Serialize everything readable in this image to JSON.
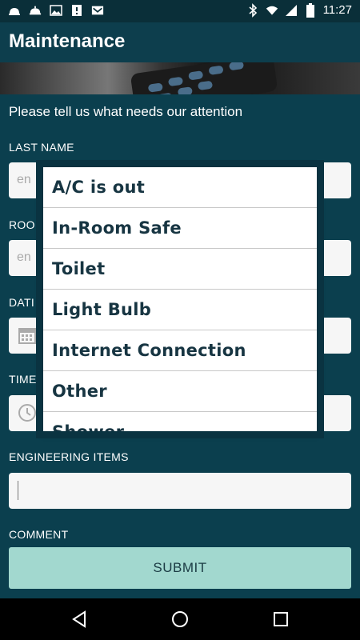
{
  "status_bar": {
    "time": "11:27",
    "left_icons": [
      "bell-icon",
      "service-bell-icon",
      "image-icon",
      "sim-icon",
      "mail-icon"
    ],
    "right_icons": [
      "bluetooth-icon",
      "wifi-icon",
      "cellular-icon",
      "battery-icon"
    ]
  },
  "app_bar": {
    "title": "Maintenance"
  },
  "form": {
    "prompt": "Please tell us what needs our attention",
    "last_name": {
      "label": "LAST NAME",
      "placeholder": "en"
    },
    "room": {
      "label": "ROO",
      "placeholder": "en"
    },
    "date": {
      "label": "DATI"
    },
    "time": {
      "label": "TIME"
    },
    "engineering_items": {
      "label": "ENGINEERING ITEMS",
      "value": ""
    },
    "comment": {
      "label": "COMMENT"
    },
    "submit_label": "SUBMIT"
  },
  "dropdown": {
    "options": [
      "A/C is out",
      "In-Room Safe",
      "Toilet",
      "Light Bulb",
      "Internet Connection",
      "Other",
      "Shower"
    ]
  },
  "colors": {
    "background": "#0b3f4e",
    "accent_button": "#a2d8cf",
    "dropdown_text": "#173542"
  }
}
